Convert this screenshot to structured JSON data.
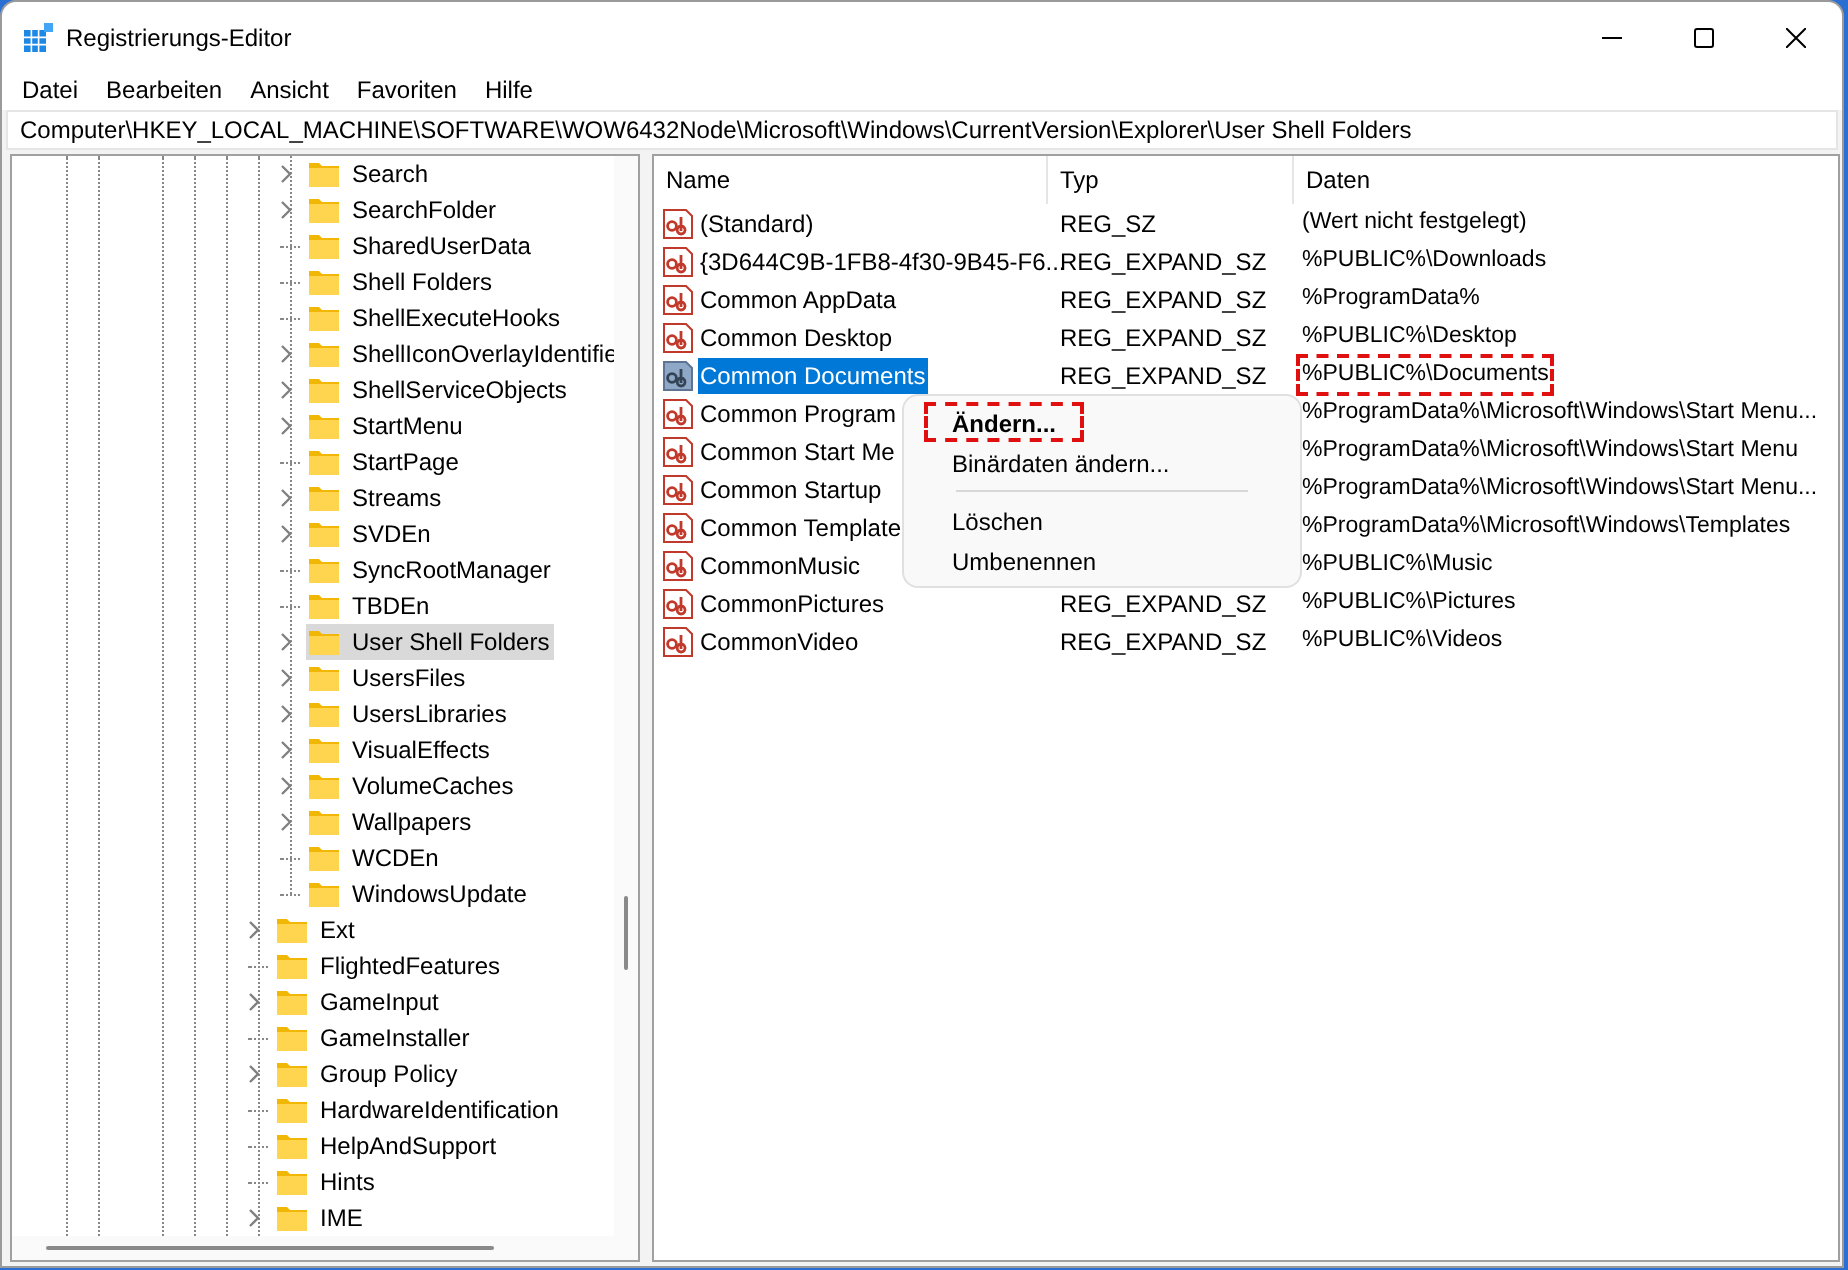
{
  "window": {
    "title": "Registrierungs-Editor"
  },
  "menu": [
    "Datei",
    "Bearbeiten",
    "Ansicht",
    "Favoriten",
    "Hilfe"
  ],
  "address": "Computer\\HKEY_LOCAL_MACHINE\\SOFTWARE\\WOW6432Node\\Microsoft\\Windows\\CurrentVersion\\Explorer\\User Shell Folders",
  "tree": [
    {
      "children": [
        {
          "label": "Search",
          "expandable": true,
          "selected": false
        },
        {
          "label": "SearchFolder",
          "expandable": true,
          "selected": false
        },
        {
          "label": "SharedUserData",
          "expandable": false,
          "selected": false
        },
        {
          "label": "Shell Folders",
          "expandable": false,
          "selected": false
        },
        {
          "label": "ShellExecuteHooks",
          "expandable": false,
          "selected": false
        },
        {
          "label": "ShellIconOverlayIdentifie",
          "expandable": true,
          "selected": false
        },
        {
          "label": "ShellServiceObjects",
          "expandable": true,
          "selected": false
        },
        {
          "label": "StartMenu",
          "expandable": true,
          "selected": false
        },
        {
          "label": "StartPage",
          "expandable": false,
          "selected": false
        },
        {
          "label": "Streams",
          "expandable": true,
          "selected": false
        },
        {
          "label": "SVDEn",
          "expandable": true,
          "selected": false
        },
        {
          "label": "SyncRootManager",
          "expandable": false,
          "selected": false
        },
        {
          "label": "TBDEn",
          "expandable": false,
          "selected": false
        },
        {
          "label": "User Shell Folders",
          "expandable": true,
          "selected": true
        },
        {
          "label": "UsersFiles",
          "expandable": true,
          "selected": false
        },
        {
          "label": "UsersLibraries",
          "expandable": true,
          "selected": false
        },
        {
          "label": "VisualEffects",
          "expandable": true,
          "selected": false
        },
        {
          "label": "VolumeCaches",
          "expandable": true,
          "selected": false
        },
        {
          "label": "Wallpapers",
          "expandable": true,
          "selected": false
        },
        {
          "label": "WCDEn",
          "expandable": false,
          "selected": false
        },
        {
          "label": "WindowsUpdate",
          "expandable": false,
          "selected": false
        }
      ]
    },
    {
      "label": "Ext",
      "expandable": true,
      "selected": false
    },
    {
      "label": "FlightedFeatures",
      "expandable": false,
      "selected": false
    },
    {
      "label": "GameInput",
      "expandable": true,
      "selected": false
    },
    {
      "label": "GameInstaller",
      "expandable": false,
      "selected": false
    },
    {
      "label": "Group Policy",
      "expandable": true,
      "selected": false
    },
    {
      "label": "HardwareIdentification",
      "expandable": false,
      "selected": false
    },
    {
      "label": "HelpAndSupport",
      "expandable": false,
      "selected": false
    },
    {
      "label": "Hints",
      "expandable": false,
      "selected": false
    },
    {
      "label": "IME",
      "expandable": true,
      "selected": false
    }
  ],
  "table": {
    "columns": [
      "Name",
      "Typ",
      "Daten"
    ],
    "rows": [
      {
        "name": "(Standard)",
        "type": "REG_SZ",
        "data": "(Wert nicht festgelegt)",
        "selected": false,
        "marked": false
      },
      {
        "name": "{3D644C9B-1FB8-4f30-9B45-F6...",
        "type": "REG_EXPAND_SZ",
        "data": "%PUBLIC%\\Downloads",
        "selected": false,
        "marked": false
      },
      {
        "name": "Common AppData",
        "type": "REG_EXPAND_SZ",
        "data": "%ProgramData%",
        "selected": false,
        "marked": false
      },
      {
        "name": "Common Desktop",
        "type": "REG_EXPAND_SZ",
        "data": "%PUBLIC%\\Desktop",
        "selected": false,
        "marked": false
      },
      {
        "name": "Common Documents",
        "type": "REG_EXPAND_SZ",
        "data": "%PUBLIC%\\Documents",
        "selected": true,
        "marked": true
      },
      {
        "name": "Common Program",
        "data": "%ProgramData%\\Microsoft\\Windows\\Start Menu...",
        "selected": false,
        "marked": false
      },
      {
        "name": "Common Start Me",
        "data": "%ProgramData%\\Microsoft\\Windows\\Start Menu",
        "selected": false,
        "marked": false
      },
      {
        "name": "Common Startup",
        "data": "%ProgramData%\\Microsoft\\Windows\\Start Menu...",
        "selected": false,
        "marked": false
      },
      {
        "name": "Common Template",
        "data": "%ProgramData%\\Microsoft\\Windows\\Templates",
        "selected": false,
        "marked": false
      },
      {
        "name": "CommonMusic",
        "data": "%PUBLIC%\\Music",
        "selected": false,
        "marked": false
      },
      {
        "name": "CommonPictures",
        "type": "REG_EXPAND_SZ",
        "data": "%PUBLIC%\\Pictures",
        "selected": false,
        "marked": false
      },
      {
        "name": "CommonVideo",
        "type": "REG_EXPAND_SZ",
        "data": "%PUBLIC%\\Videos",
        "selected": false,
        "marked": false
      }
    ]
  },
  "context_menu": [
    {
      "kind": "item",
      "label": "Ändern...",
      "default": true,
      "marked": true
    },
    {
      "kind": "item",
      "label": "Binärdaten ändern...",
      "default": false,
      "marked": false
    },
    {
      "kind": "separator"
    },
    {
      "kind": "item",
      "label": "Löschen",
      "default": false,
      "marked": false
    },
    {
      "kind": "item",
      "label": "Umbenennen",
      "default": false,
      "marked": false
    }
  ]
}
